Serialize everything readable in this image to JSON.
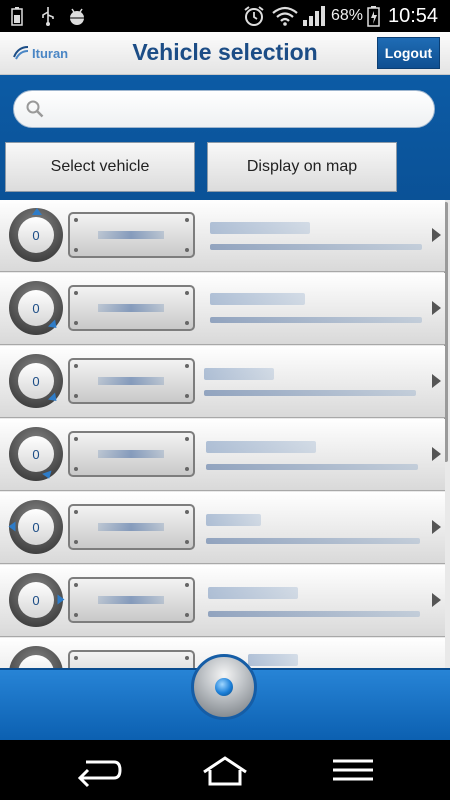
{
  "status_bar": {
    "battery_percent": "68%",
    "time": "10:54",
    "icons": [
      "battery-icon",
      "usb-icon",
      "android-debug-icon",
      "alarm-icon",
      "wifi-icon",
      "signal-icon",
      "battery-charging-icon"
    ]
  },
  "header": {
    "logo_text": "Ituran",
    "title": "Vehicle selection",
    "logout_label": "Logout"
  },
  "search": {
    "placeholder": ""
  },
  "actions": {
    "select_vehicle_label": "Select vehicle",
    "display_on_map_label": "Display on map"
  },
  "vehicles": [
    {
      "speed": "0",
      "arrow": "top"
    },
    {
      "speed": "0",
      "arrow": "bottom-right"
    },
    {
      "speed": "0",
      "arrow": "bottom-right"
    },
    {
      "speed": "0",
      "arrow": "bottom-right"
    },
    {
      "speed": "0",
      "arrow": "left"
    },
    {
      "speed": "0",
      "arrow": "right"
    },
    {
      "speed": "",
      "arrow": "none"
    }
  ],
  "colors": {
    "brand_blue": "#0c5ba5",
    "title_blue": "#1c4d86"
  },
  "navigation": [
    "back-icon",
    "home-icon",
    "menu-icon"
  ]
}
